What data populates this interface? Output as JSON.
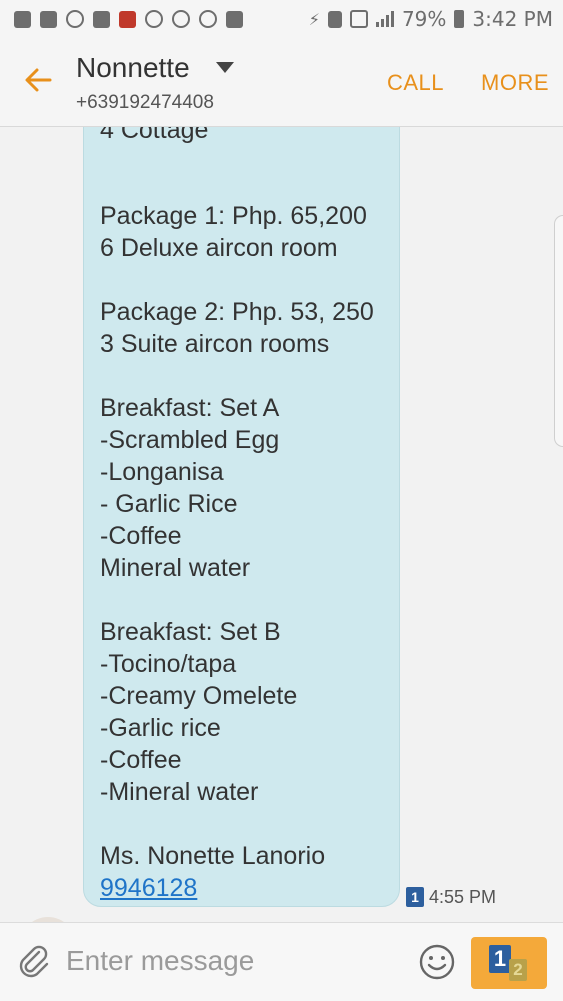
{
  "status_bar": {
    "battery_percent": "79%",
    "time": "3:42 PM",
    "icons": [
      "chat-icon",
      "facebook-icon",
      "viber-icon",
      "gallery-icon",
      "news-icon",
      "uae-icon",
      "instagram-icon",
      "sync-icon",
      "facebook-icon",
      "charging-icon",
      "sim1-icon",
      "no-signal-icon",
      "signal-icon",
      "battery-icon"
    ]
  },
  "header": {
    "contact_name": "Nonnette",
    "contact_number": "+639192474408",
    "call_label": "CALL",
    "more_label": "MORE"
  },
  "message": {
    "partial_top_line": "4 Cottage",
    "body": "Package 1: Php. 65,200\n6 Deluxe aircon room\n\nPackage 2: Php. 53, 250\n3 Suite aircon rooms\n\nBreakfast: Set A\n-Scrambled Egg\n-Longanisa\n- Garlic Rice\n-Coffee\nMineral water\n\nBreakfast: Set B\n-Tocino/tapa\n-Creamy Omelete\n-Garlic rice\n-Coffee\n-Mineral water\n\nMs. Nonette Lanorio",
    "link": "9946128",
    "sim_badge": "1",
    "time": "4:55 PM"
  },
  "composer": {
    "placeholder": "Enter message",
    "send_sim_primary": "1",
    "send_sim_secondary": "2"
  },
  "colors": {
    "accent": "#e8901b",
    "bubble": "#cfe9ee",
    "link": "#1f74c8",
    "send_button": "#f4a93a"
  }
}
